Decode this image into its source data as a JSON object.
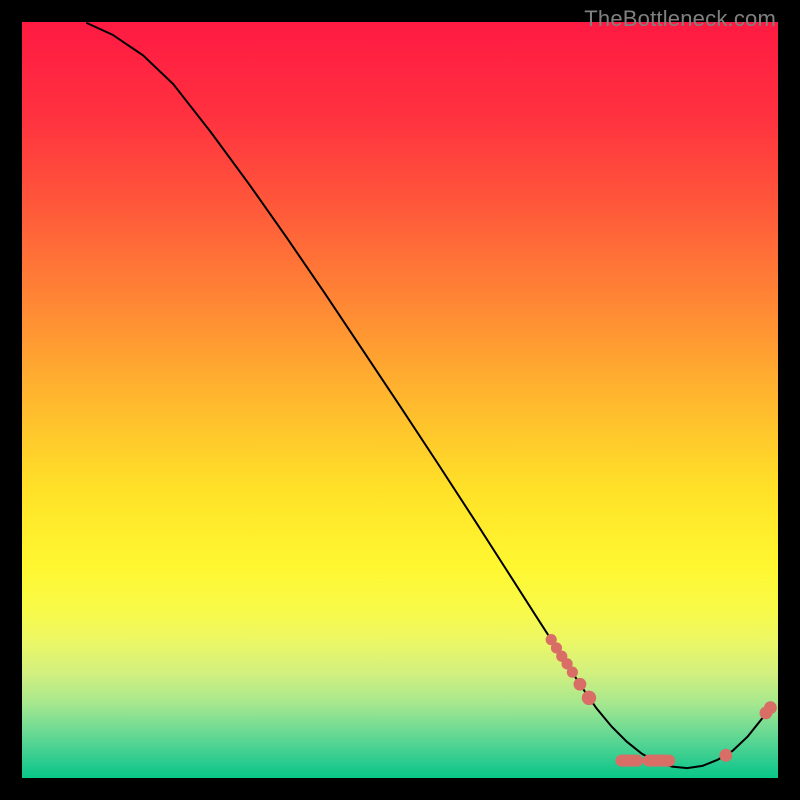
{
  "watermark": "TheBottleneck.com",
  "chart_data": {
    "type": "line",
    "title": "",
    "xlabel": "",
    "ylabel": "",
    "xlim": [
      0,
      100
    ],
    "ylim": [
      0,
      100
    ],
    "curve": [
      {
        "x": 8.5,
        "y": 99.9
      },
      {
        "x": 12,
        "y": 98.3
      },
      {
        "x": 16,
        "y": 95.6
      },
      {
        "x": 20,
        "y": 91.8
      },
      {
        "x": 25,
        "y": 85.4
      },
      {
        "x": 30,
        "y": 78.6
      },
      {
        "x": 35,
        "y": 71.5
      },
      {
        "x": 40,
        "y": 64.2
      },
      {
        "x": 45,
        "y": 56.7
      },
      {
        "x": 50,
        "y": 49.2
      },
      {
        "x": 55,
        "y": 41.6
      },
      {
        "x": 60,
        "y": 33.9
      },
      {
        "x": 65,
        "y": 26.1
      },
      {
        "x": 68,
        "y": 21.4
      },
      {
        "x": 70,
        "y": 18.3
      },
      {
        "x": 72,
        "y": 15.2
      },
      {
        "x": 74,
        "y": 12.1
      },
      {
        "x": 76,
        "y": 9.2
      },
      {
        "x": 78,
        "y": 6.8
      },
      {
        "x": 80,
        "y": 4.8
      },
      {
        "x": 82,
        "y": 3.2
      },
      {
        "x": 84,
        "y": 2.1
      },
      {
        "x": 86,
        "y": 1.5
      },
      {
        "x": 88,
        "y": 1.3
      },
      {
        "x": 90,
        "y": 1.6
      },
      {
        "x": 92,
        "y": 2.4
      },
      {
        "x": 94,
        "y": 3.6
      },
      {
        "x": 96,
        "y": 5.5
      },
      {
        "x": 98,
        "y": 8.0
      },
      {
        "x": 99,
        "y": 9.4
      }
    ],
    "markers": [
      {
        "x": 70.0,
        "y": 18.3,
        "r": 2.8
      },
      {
        "x": 70.7,
        "y": 17.2,
        "r": 2.8
      },
      {
        "x": 71.4,
        "y": 16.1,
        "r": 2.8
      },
      {
        "x": 72.1,
        "y": 15.1,
        "r": 2.8
      },
      {
        "x": 72.8,
        "y": 14.0,
        "r": 2.8
      },
      {
        "x": 73.8,
        "y": 12.4,
        "r": 3.2
      },
      {
        "x": 75.0,
        "y": 10.6,
        "r": 3.6
      },
      {
        "x": 79.3,
        "y": 2.3,
        "r": 3.0
      },
      {
        "x": 79.5,
        "y": 2.3,
        "r": 3.0
      },
      {
        "x": 79.8,
        "y": 2.3,
        "r": 3.0
      },
      {
        "x": 80.0,
        "y": 2.3,
        "r": 3.0
      },
      {
        "x": 80.2,
        "y": 2.3,
        "r": 3.0
      },
      {
        "x": 80.4,
        "y": 2.3,
        "r": 3.0
      },
      {
        "x": 80.7,
        "y": 2.3,
        "r": 3.0
      },
      {
        "x": 80.9,
        "y": 2.3,
        "r": 3.0
      },
      {
        "x": 81.2,
        "y": 2.3,
        "r": 3.0
      },
      {
        "x": 81.4,
        "y": 2.3,
        "r": 3.0
      },
      {
        "x": 82.9,
        "y": 2.3,
        "r": 3.0
      },
      {
        "x": 83.1,
        "y": 2.3,
        "r": 3.0
      },
      {
        "x": 83.4,
        "y": 2.3,
        "r": 3.0
      },
      {
        "x": 83.6,
        "y": 2.3,
        "r": 3.0
      },
      {
        "x": 83.8,
        "y": 2.3,
        "r": 3.0
      },
      {
        "x": 84.1,
        "y": 2.3,
        "r": 3.0
      },
      {
        "x": 84.3,
        "y": 2.3,
        "r": 3.0
      },
      {
        "x": 84.5,
        "y": 2.3,
        "r": 3.0
      },
      {
        "x": 84.8,
        "y": 2.3,
        "r": 3.0
      },
      {
        "x": 85.0,
        "y": 2.3,
        "r": 3.0
      },
      {
        "x": 85.3,
        "y": 2.3,
        "r": 3.0
      },
      {
        "x": 85.6,
        "y": 2.3,
        "r": 3.0
      },
      {
        "x": 93.1,
        "y": 3.0,
        "r": 3.2
      },
      {
        "x": 98.4,
        "y": 8.6,
        "r": 3.2
      },
      {
        "x": 99.0,
        "y": 9.3,
        "r": 3.2
      }
    ],
    "gradient_stops": [
      {
        "offset": 0.0,
        "color": "#ff1a42"
      },
      {
        "offset": 0.12,
        "color": "#ff3040"
      },
      {
        "offset": 0.25,
        "color": "#ff5a3a"
      },
      {
        "offset": 0.38,
        "color": "#ff8a34"
      },
      {
        "offset": 0.5,
        "color": "#ffb82e"
      },
      {
        "offset": 0.62,
        "color": "#ffe228"
      },
      {
        "offset": 0.72,
        "color": "#fff730"
      },
      {
        "offset": 0.78,
        "color": "#f8fa4a"
      },
      {
        "offset": 0.82,
        "color": "#ebf766"
      },
      {
        "offset": 0.86,
        "color": "#d3f07e"
      },
      {
        "offset": 0.9,
        "color": "#a8e88e"
      },
      {
        "offset": 0.93,
        "color": "#79dd93"
      },
      {
        "offset": 0.96,
        "color": "#4ad292"
      },
      {
        "offset": 0.985,
        "color": "#20c98d"
      },
      {
        "offset": 1.0,
        "color": "#08c788"
      }
    ],
    "curve_color": "#000000",
    "marker_color": "#d86e66"
  }
}
